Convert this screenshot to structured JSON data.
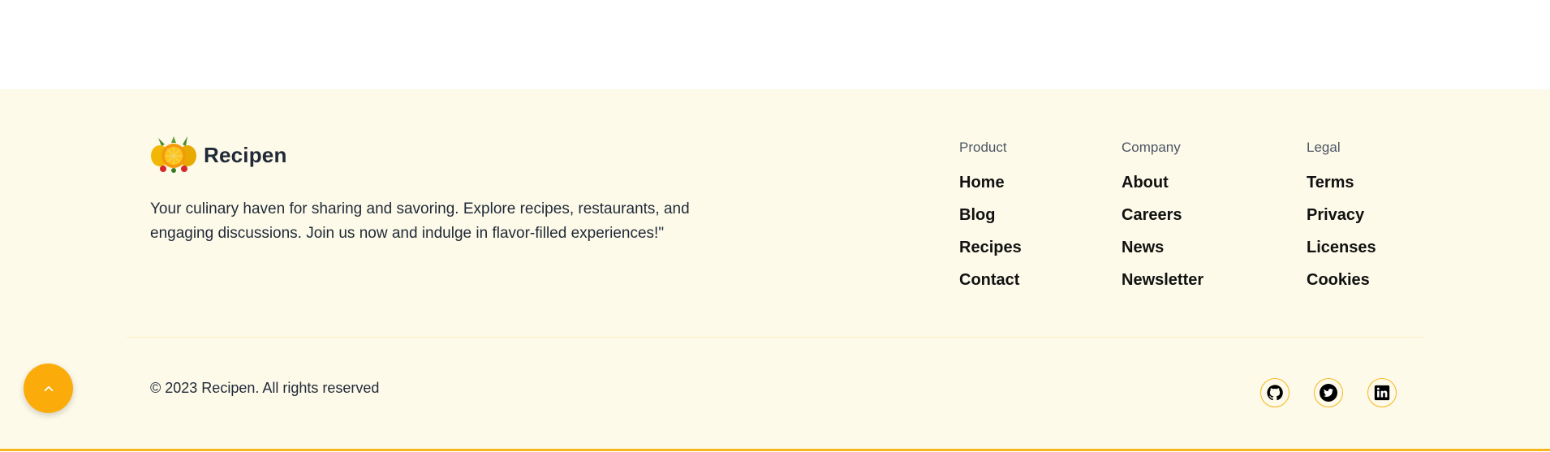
{
  "brand": {
    "name": "Recipen",
    "tagline": "Your culinary haven for sharing and savoring. Explore recipes, restaurants, and engaging discussions. Join us now and indulge in flavor-filled experiences!\""
  },
  "columns": {
    "product": {
      "title": "Product",
      "links": [
        "Home",
        "Blog",
        "Recipes",
        "Contact"
      ]
    },
    "company": {
      "title": "Company",
      "links": [
        "About",
        "Careers",
        "News",
        "Newsletter"
      ]
    },
    "legal": {
      "title": "Legal",
      "links": [
        "Terms",
        "Privacy",
        "Licenses",
        "Cookies"
      ]
    }
  },
  "copyright": "© 2023 Recipen. All rights reserved",
  "socials": [
    "github-icon",
    "twitter-icon",
    "linkedin-icon"
  ],
  "scroll_top_icon": "chevron-up-icon",
  "colors": {
    "footer_bg": "#fdfae9",
    "accent": "#fbab0a",
    "border_accent": "#f7b61c",
    "text": "#1f2937"
  }
}
